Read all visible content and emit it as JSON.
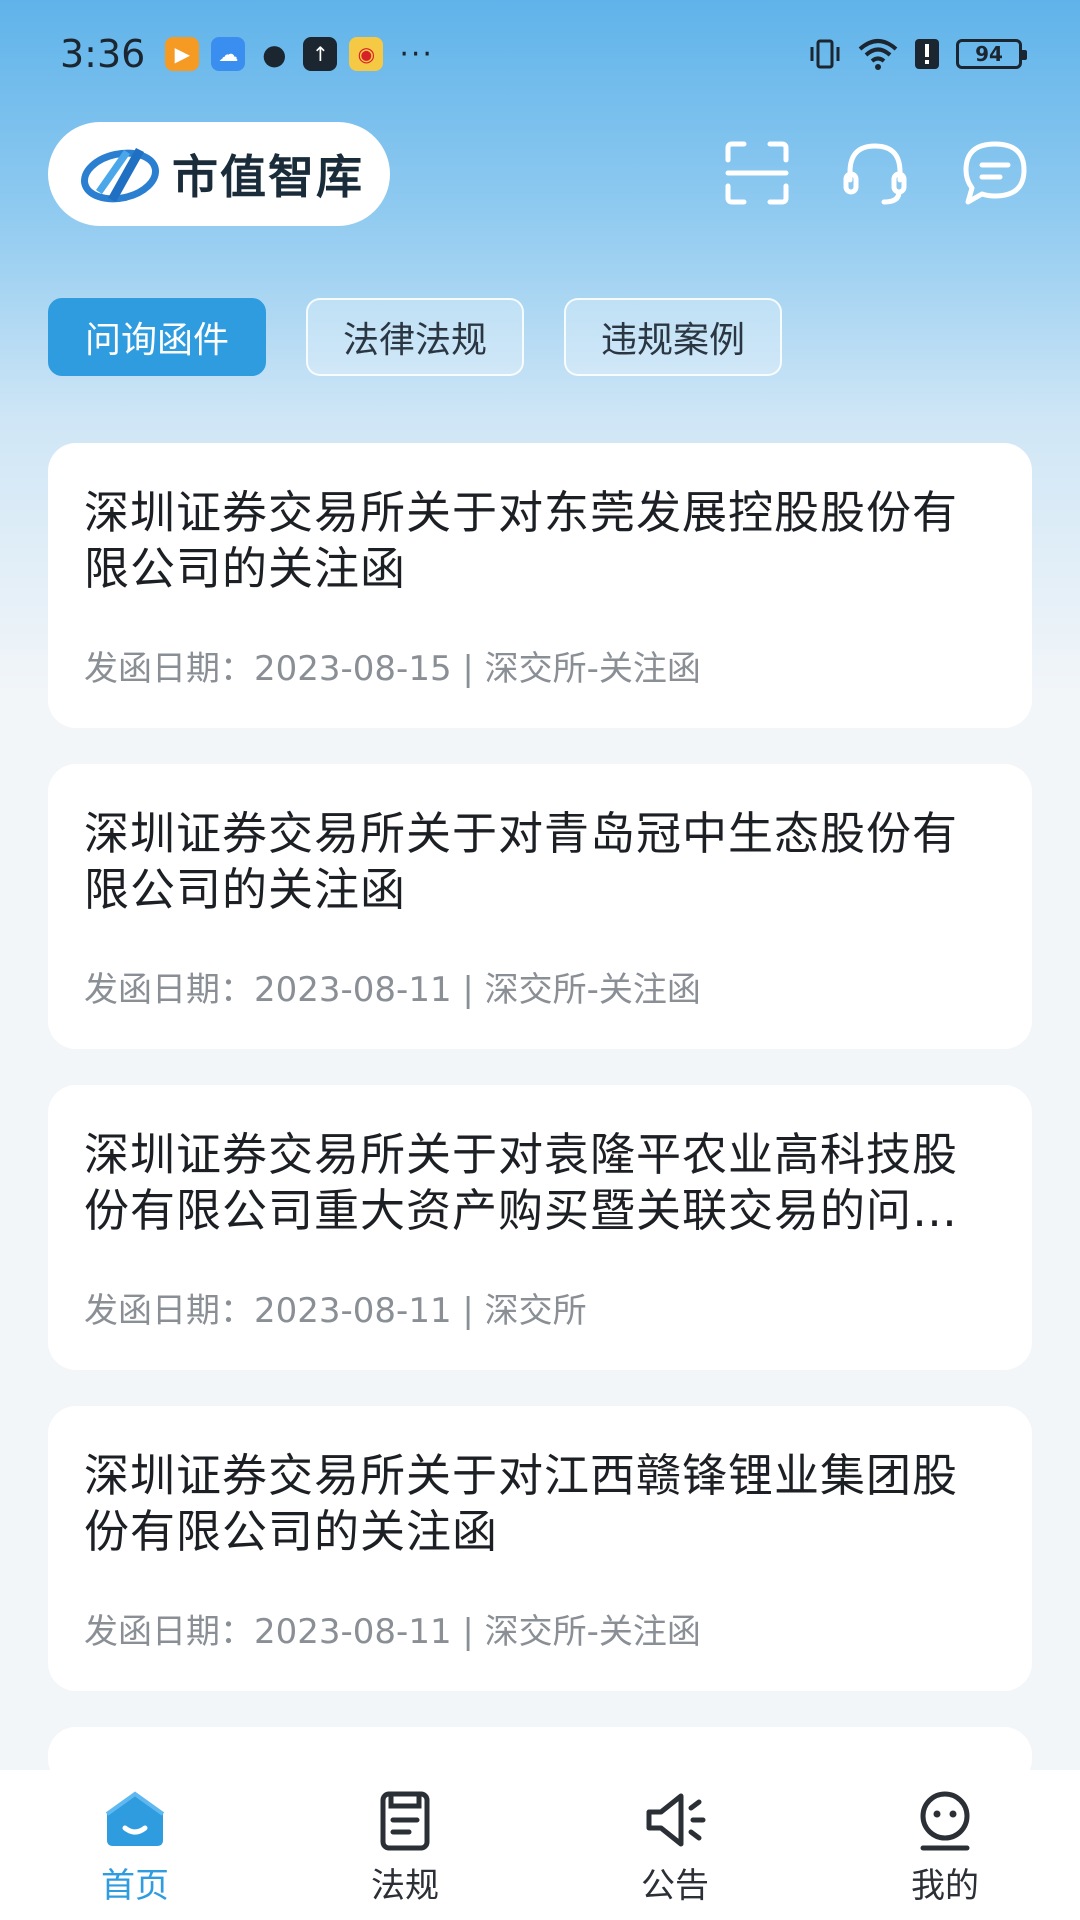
{
  "status_bar": {
    "time": "3:36",
    "more": "···",
    "battery": "94"
  },
  "header": {
    "logo_text": "市值智库",
    "icons": [
      "scan-icon",
      "headset-icon",
      "message-icon"
    ]
  },
  "tabs": [
    {
      "label": "问询函件",
      "active": true
    },
    {
      "label": "法律法规",
      "active": false
    },
    {
      "label": "违规案例",
      "active": false
    }
  ],
  "cards": [
    {
      "title": "深圳证券交易所关于对东莞发展控股股份有限公司的关注函",
      "meta": "发函日期：2023-08-15 | 深交所-关注函"
    },
    {
      "title": "深圳证券交易所关于对青岛冠中生态股份有限公司的关注函",
      "meta": "发函日期：2023-08-11 | 深交所-关注函"
    },
    {
      "title": "深圳证券交易所关于对袁隆平农业高科技股份有限公司重大资产购买暨关联交易的问询函",
      "meta": "发函日期：2023-08-11 | 深交所"
    },
    {
      "title": "深圳证券交易所关于对江西赣锋锂业集团股份有限公司的关注函",
      "meta": "发函日期：2023-08-11 | 深交所-关注函"
    }
  ],
  "bottom_nav": [
    {
      "label": "首页",
      "icon": "home-icon",
      "active": true
    },
    {
      "label": "法规",
      "icon": "book-icon",
      "active": false
    },
    {
      "label": "公告",
      "icon": "megaphone-icon",
      "active": false
    },
    {
      "label": "我的",
      "icon": "profile-icon",
      "active": false
    }
  ],
  "colors": {
    "accent": "#2f9ce0",
    "header_gradient_top": "#5fb3ea"
  }
}
